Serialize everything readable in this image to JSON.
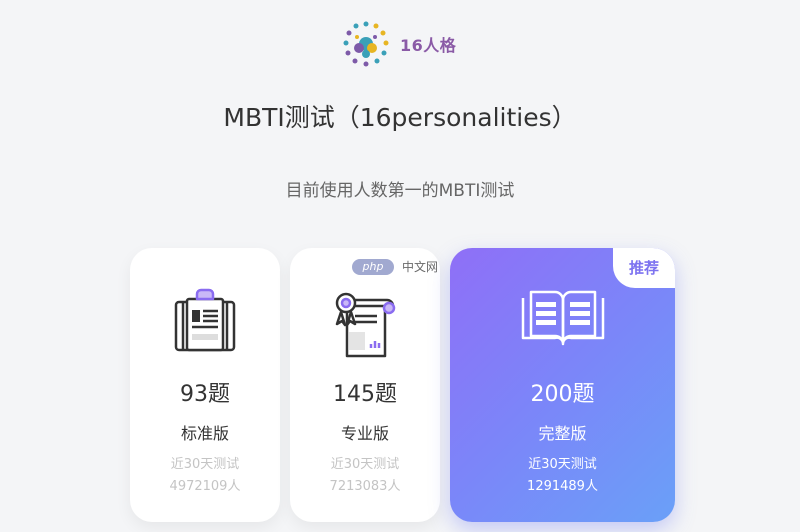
{
  "logo": {
    "text": "16人格"
  },
  "title": "MBTI测试（16personalities）",
  "subtitle": "目前使用人数第一的MBTI测试",
  "cards": [
    {
      "count": "93题",
      "edition": "标准版",
      "recent_label": "近30天测试",
      "recent_value": "4972109人",
      "icon": "clipboard-icon"
    },
    {
      "count": "145题",
      "edition": "专业版",
      "recent_label": "近30天测试",
      "recent_value": "7213083人",
      "icon": "document-flower-icon"
    },
    {
      "count": "200题",
      "edition": "完整版",
      "recent_label": "近30天测试",
      "recent_value": "1291489人",
      "icon": "open-book-icon",
      "badge": "推荐"
    }
  ],
  "watermark": {
    "logo": "php",
    "text": "中文网"
  },
  "colors": {
    "accent_gradient_start": "#8f6ff7",
    "accent_gradient_end": "#6aa0f8",
    "logo_purple": "#8a5aa6"
  }
}
